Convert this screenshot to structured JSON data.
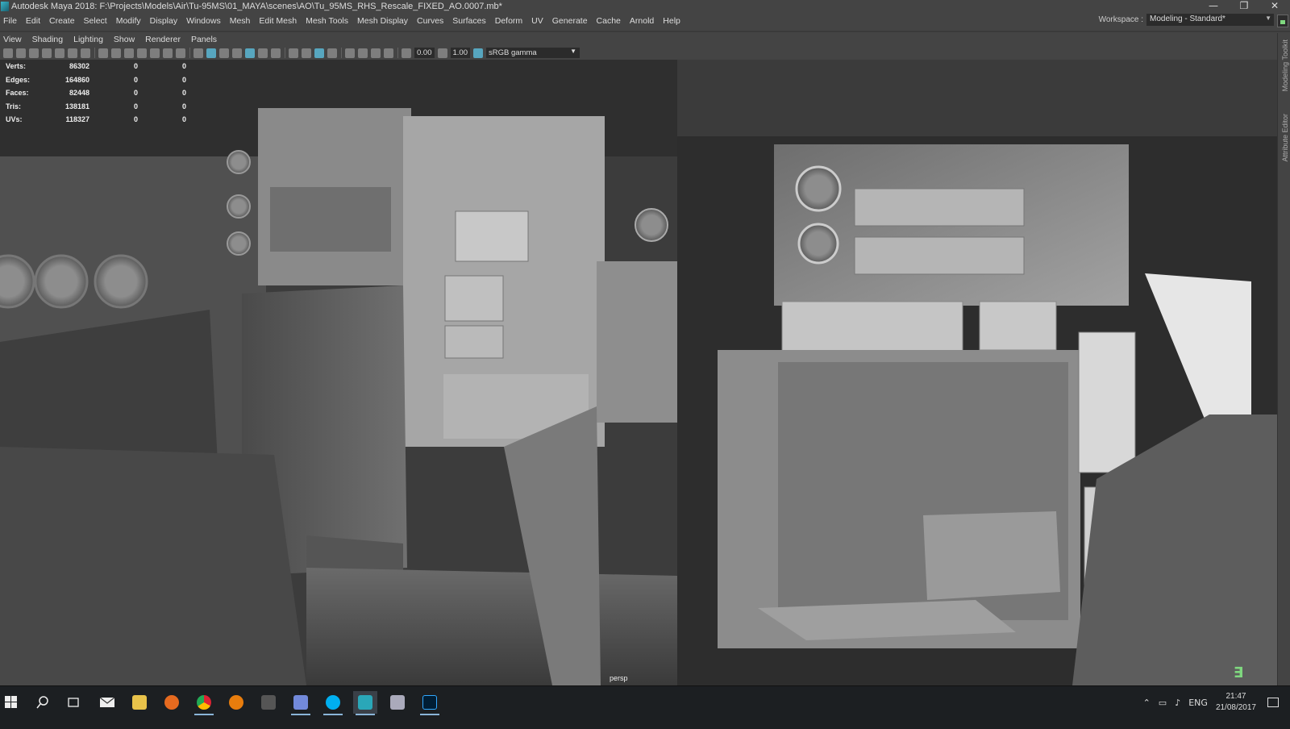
{
  "window": {
    "title": "Autodesk Maya 2018: F:\\Projects\\Models\\Air\\Tu-95MS\\01_MAYA\\scenes\\AO\\Tu_95MS_RHS_Rescale_FIXED_AO.0007.mb*",
    "minimize": "—",
    "restore": "❐",
    "close": "✕"
  },
  "menu": {
    "items": [
      "File",
      "Edit",
      "Create",
      "Select",
      "Modify",
      "Display",
      "Windows",
      "Mesh",
      "Edit Mesh",
      "Mesh Tools",
      "Mesh Display",
      "Curves",
      "Surfaces",
      "Deform",
      "UV",
      "Generate",
      "Cache",
      "Arnold",
      "Help"
    ]
  },
  "workspace": {
    "label": "Workspace :",
    "value": "Modeling - Standard*"
  },
  "panel_menu": {
    "items": [
      "View",
      "Shading",
      "Lighting",
      "Show",
      "Renderer",
      "Panels"
    ]
  },
  "toolbar": {
    "exposure": "0.00",
    "gamma": "1.00",
    "color_space": "sRGB gamma"
  },
  "side_tabs": {
    "modeling_toolkit": "Modeling Toolkit",
    "attribute_editor": "Attribute Editor"
  },
  "hud": {
    "rows": [
      {
        "label": "Verts:",
        "v1": "86302",
        "v2": "0",
        "v3": "0"
      },
      {
        "label": "Edges:",
        "v1": "164860",
        "v2": "0",
        "v3": "0"
      },
      {
        "label": "Faces:",
        "v1": "82448",
        "v2": "0",
        "v3": "0"
      },
      {
        "label": "Tris:",
        "v1": "138181",
        "v2": "0",
        "v3": "0"
      },
      {
        "label": "UVs:",
        "v1": "118327",
        "v2": "0",
        "v3": "0"
      }
    ]
  },
  "viewport": {
    "camera": "persp"
  },
  "taskbar": {
    "language": "ENG",
    "time": "21:47",
    "date": "21/08/2017"
  }
}
